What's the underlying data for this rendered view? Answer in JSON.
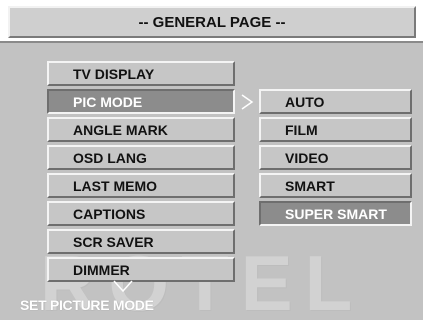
{
  "header": {
    "title": "-- GENERAL PAGE --"
  },
  "watermark": {
    "text": "ROTEL"
  },
  "menu": {
    "items": [
      {
        "label": "TV DISPLAY"
      },
      {
        "label": "PIC MODE"
      },
      {
        "label": "ANGLE MARK"
      },
      {
        "label": "OSD LANG"
      },
      {
        "label": "LAST MEMO"
      },
      {
        "label": "CAPTIONS"
      },
      {
        "label": "SCR SAVER"
      },
      {
        "label": "DIMMER"
      }
    ],
    "selected": "PIC MODE"
  },
  "submenu": {
    "options": [
      {
        "label": "AUTO"
      },
      {
        "label": "FILM"
      },
      {
        "label": "VIDEO"
      },
      {
        "label": "SMART"
      },
      {
        "label": "SUPER SMART"
      }
    ],
    "selected": "SUPER SMART"
  },
  "status": {
    "text": "SET PICTURE MODE"
  },
  "colors": {
    "panel": "#c2c2c2",
    "selected": "#8c8c8c",
    "title_bar": "#cfcfcf"
  },
  "icons": [
    "chevron-right-icon",
    "chevron-down-icon"
  ]
}
